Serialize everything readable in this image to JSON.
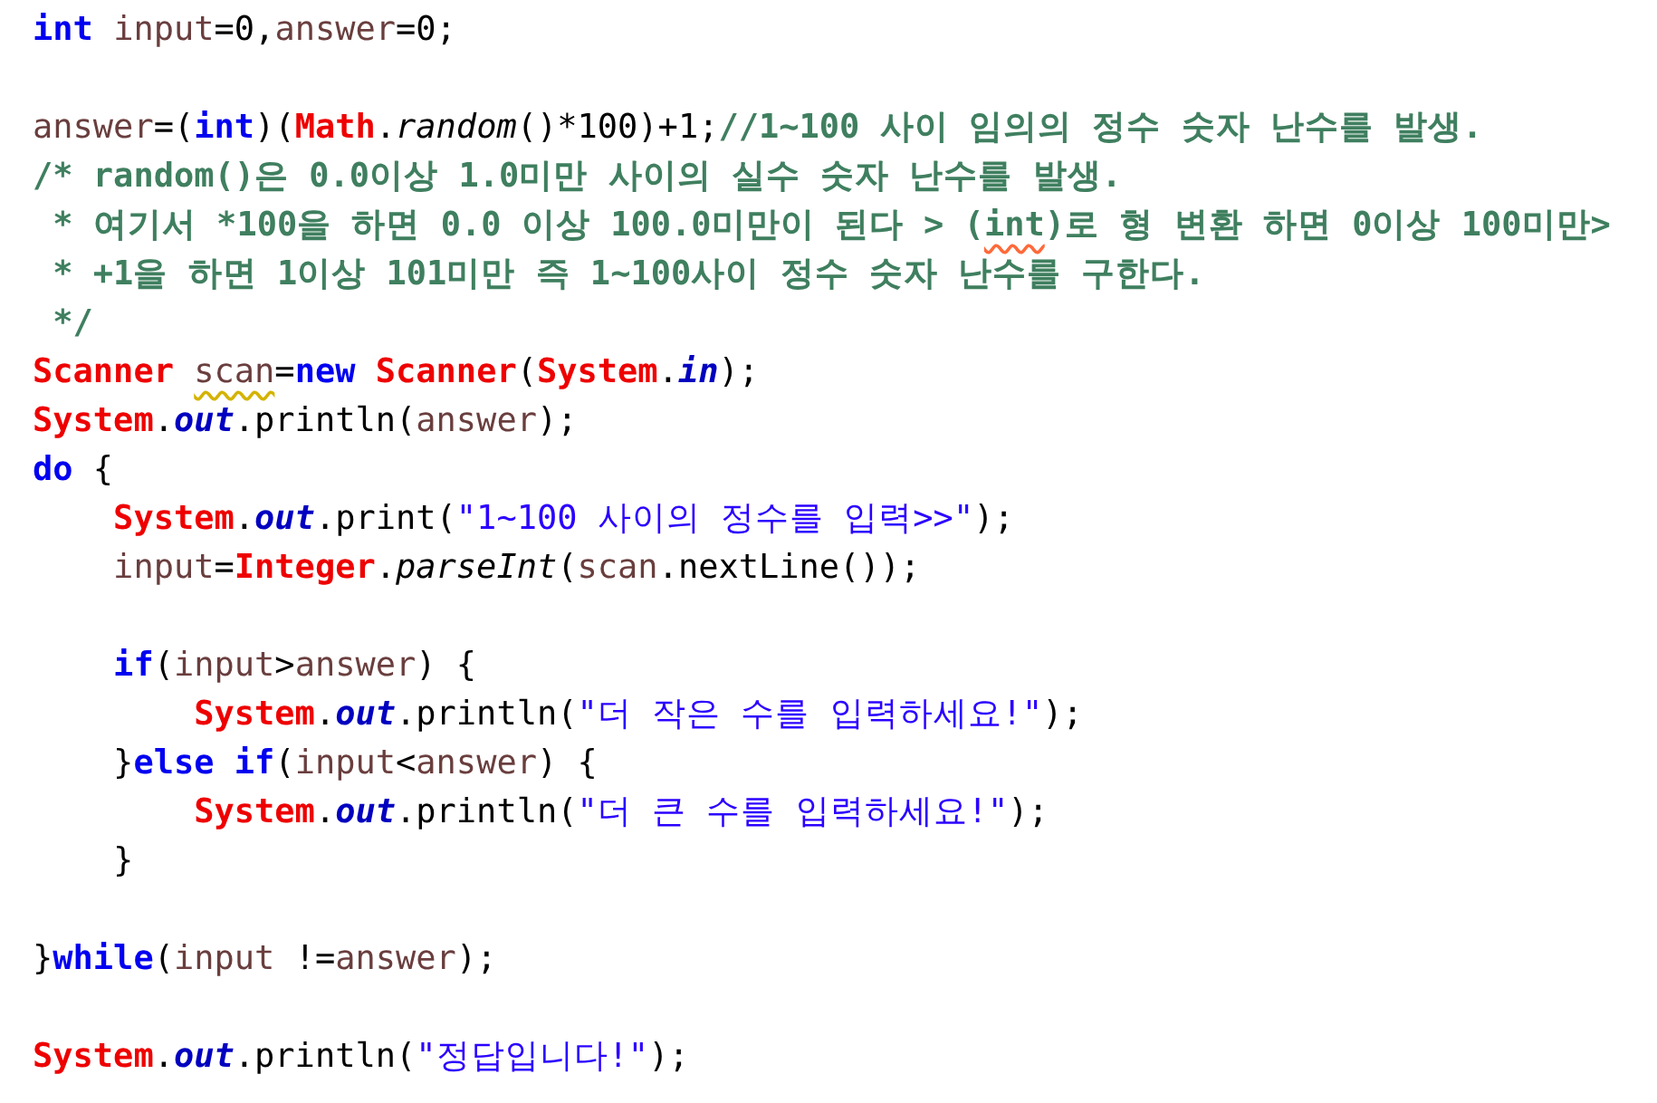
{
  "editor": {
    "lines": [
      {
        "kind": "code",
        "tokens": [
          {
            "kind": "keyword",
            "text": "int "
          },
          {
            "kind": "var",
            "text": "input"
          },
          {
            "kind": "plain",
            "text": "=0,"
          },
          {
            "kind": "var",
            "text": "answer"
          },
          {
            "kind": "plain",
            "text": "=0;"
          }
        ]
      },
      {
        "kind": "blank"
      },
      {
        "kind": "code",
        "tokens": [
          {
            "kind": "var",
            "text": "answer"
          },
          {
            "kind": "plain",
            "text": "=("
          },
          {
            "kind": "keyword",
            "text": "int"
          },
          {
            "kind": "plain",
            "text": ")("
          },
          {
            "kind": "type",
            "text": "Math"
          },
          {
            "kind": "plain",
            "text": "."
          },
          {
            "kind": "method",
            "text": "random"
          },
          {
            "kind": "plain",
            "text": "()*100)+1;"
          },
          {
            "kind": "comment",
            "text": "//1~100 사이 임의의 정수 숫자 난수를 발생."
          }
        ]
      },
      {
        "kind": "code",
        "tokens": [
          {
            "kind": "comment",
            "text": "/* random()은 0.0이상 1.0미만 사이의 실수 숫자 난수를 발생."
          }
        ]
      },
      {
        "kind": "code",
        "tokens": [
          {
            "kind": "comment",
            "text": " * 여기서 *100을 하면 0.0 이상 100.0미만이 된다 > ("
          },
          {
            "kind": "comment",
            "text": "int",
            "spelling_error": true
          },
          {
            "kind": "comment",
            "text": ")로 형 변환 하면 0이상 100미만>"
          }
        ]
      },
      {
        "kind": "code",
        "tokens": [
          {
            "kind": "comment",
            "text": " * +1을 하면 1이상 101미만 즉 1~100사이 정수 숫자 난수를 구한다."
          }
        ]
      },
      {
        "kind": "code",
        "tokens": [
          {
            "kind": "comment",
            "text": " */"
          }
        ]
      },
      {
        "kind": "code",
        "tokens": [
          {
            "kind": "type",
            "text": "Scanner "
          },
          {
            "kind": "var",
            "text": "scan",
            "warning": true
          },
          {
            "kind": "plain",
            "text": "="
          },
          {
            "kind": "keyword",
            "text": "new "
          },
          {
            "kind": "type",
            "text": "Scanner"
          },
          {
            "kind": "plain",
            "text": "("
          },
          {
            "kind": "type",
            "text": "System"
          },
          {
            "kind": "plain",
            "text": "."
          },
          {
            "kind": "field",
            "text": "in"
          },
          {
            "kind": "plain",
            "text": ");"
          }
        ]
      },
      {
        "kind": "code",
        "tokens": [
          {
            "kind": "type",
            "text": "System"
          },
          {
            "kind": "plain",
            "text": "."
          },
          {
            "kind": "field",
            "text": "out"
          },
          {
            "kind": "plain",
            "text": ".println("
          },
          {
            "kind": "var",
            "text": "answer"
          },
          {
            "kind": "plain",
            "text": ");"
          }
        ]
      },
      {
        "kind": "code",
        "tokens": [
          {
            "kind": "keyword",
            "text": "do"
          },
          {
            "kind": "plain",
            "text": " {"
          }
        ]
      },
      {
        "kind": "code",
        "tokens": [
          {
            "kind": "type",
            "text": "    System"
          },
          {
            "kind": "plain",
            "text": "."
          },
          {
            "kind": "field",
            "text": "out"
          },
          {
            "kind": "plain",
            "text": ".print("
          },
          {
            "kind": "string",
            "text": "\"1~100 사이의 정수를 입력>>\""
          },
          {
            "kind": "plain",
            "text": ");"
          }
        ]
      },
      {
        "kind": "code",
        "tokens": [
          {
            "kind": "var",
            "text": "    input"
          },
          {
            "kind": "plain",
            "text": "="
          },
          {
            "kind": "type",
            "text": "Integer"
          },
          {
            "kind": "plain",
            "text": "."
          },
          {
            "kind": "method",
            "text": "parseInt"
          },
          {
            "kind": "plain",
            "text": "("
          },
          {
            "kind": "var",
            "text": "scan"
          },
          {
            "kind": "plain",
            "text": ".nextLine());"
          }
        ]
      },
      {
        "kind": "blank"
      },
      {
        "kind": "code",
        "tokens": [
          {
            "kind": "keyword",
            "text": "    if"
          },
          {
            "kind": "plain",
            "text": "("
          },
          {
            "kind": "var",
            "text": "input"
          },
          {
            "kind": "plain",
            "text": ">"
          },
          {
            "kind": "var",
            "text": "answer"
          },
          {
            "kind": "plain",
            "text": ") {"
          }
        ]
      },
      {
        "kind": "code",
        "tokens": [
          {
            "kind": "type",
            "text": "        System"
          },
          {
            "kind": "plain",
            "text": "."
          },
          {
            "kind": "field",
            "text": "out"
          },
          {
            "kind": "plain",
            "text": ".println("
          },
          {
            "kind": "string",
            "text": "\"더 작은 수를 입력하세요!\""
          },
          {
            "kind": "plain",
            "text": ");"
          }
        ]
      },
      {
        "kind": "code",
        "tokens": [
          {
            "kind": "plain",
            "text": "    }"
          },
          {
            "kind": "keyword",
            "text": "else if"
          },
          {
            "kind": "plain",
            "text": "("
          },
          {
            "kind": "var",
            "text": "input"
          },
          {
            "kind": "plain",
            "text": "<"
          },
          {
            "kind": "var",
            "text": "answer"
          },
          {
            "kind": "plain",
            "text": ") {"
          }
        ]
      },
      {
        "kind": "code",
        "tokens": [
          {
            "kind": "type",
            "text": "        System"
          },
          {
            "kind": "plain",
            "text": "."
          },
          {
            "kind": "field",
            "text": "out"
          },
          {
            "kind": "plain",
            "text": ".println("
          },
          {
            "kind": "string",
            "text": "\"더 큰 수를 입력하세요!\""
          },
          {
            "kind": "plain",
            "text": ");"
          }
        ]
      },
      {
        "kind": "code",
        "tokens": [
          {
            "kind": "plain",
            "text": "    }"
          }
        ]
      },
      {
        "kind": "blank"
      },
      {
        "kind": "code",
        "tokens": [
          {
            "kind": "plain",
            "text": "}"
          },
          {
            "kind": "keyword",
            "text": "while"
          },
          {
            "kind": "plain",
            "text": "("
          },
          {
            "kind": "var",
            "text": "input"
          },
          {
            "kind": "plain",
            "text": " !="
          },
          {
            "kind": "var",
            "text": "answer"
          },
          {
            "kind": "plain",
            "text": ");"
          }
        ]
      },
      {
        "kind": "blank"
      },
      {
        "kind": "code",
        "tokens": [
          {
            "kind": "type",
            "text": "System"
          },
          {
            "kind": "plain",
            "text": "."
          },
          {
            "kind": "field",
            "text": "out"
          },
          {
            "kind": "plain",
            "text": ".println("
          },
          {
            "kind": "string",
            "text": "\"정답입니다!\""
          },
          {
            "kind": "plain",
            "text": ");"
          }
        ]
      }
    ]
  }
}
